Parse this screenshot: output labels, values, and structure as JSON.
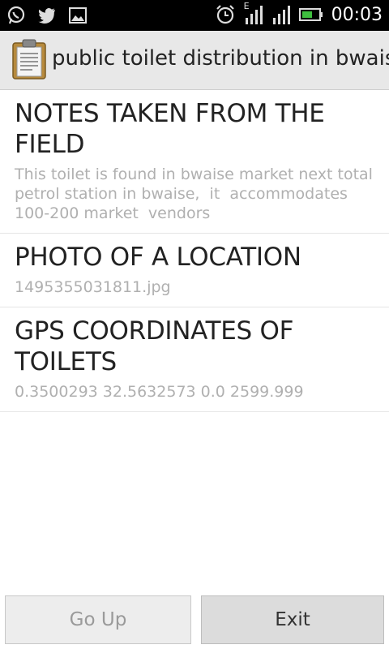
{
  "status_bar": {
    "time": "00:03",
    "network_type": "E",
    "left_icons": [
      "whatsapp-icon",
      "twitter-icon",
      "gallery-icon"
    ],
    "right_icons": [
      "alarm-icon",
      "signal-icon",
      "signal-icon",
      "battery-icon"
    ],
    "battery_color": "#3fbf3f"
  },
  "app_bar": {
    "title": "public toilet distribution in bwaise",
    "icon": "clipboard-icon"
  },
  "items": [
    {
      "title": "NOTES TAKEN FROM THE FIELD",
      "value": "This toilet is found in bwaise market next total petrol station in bwaise,  it  accommodates 100-200 market  vendors"
    },
    {
      "title": "PHOTO OF A LOCATION",
      "value": "1495355031811.jpg"
    },
    {
      "title": "GPS COORDINATES OF TOILETS",
      "value": "0.3500293 32.5632573 0.0 2599.999"
    }
  ],
  "buttons": {
    "go_up": "Go Up",
    "exit": "Exit"
  }
}
